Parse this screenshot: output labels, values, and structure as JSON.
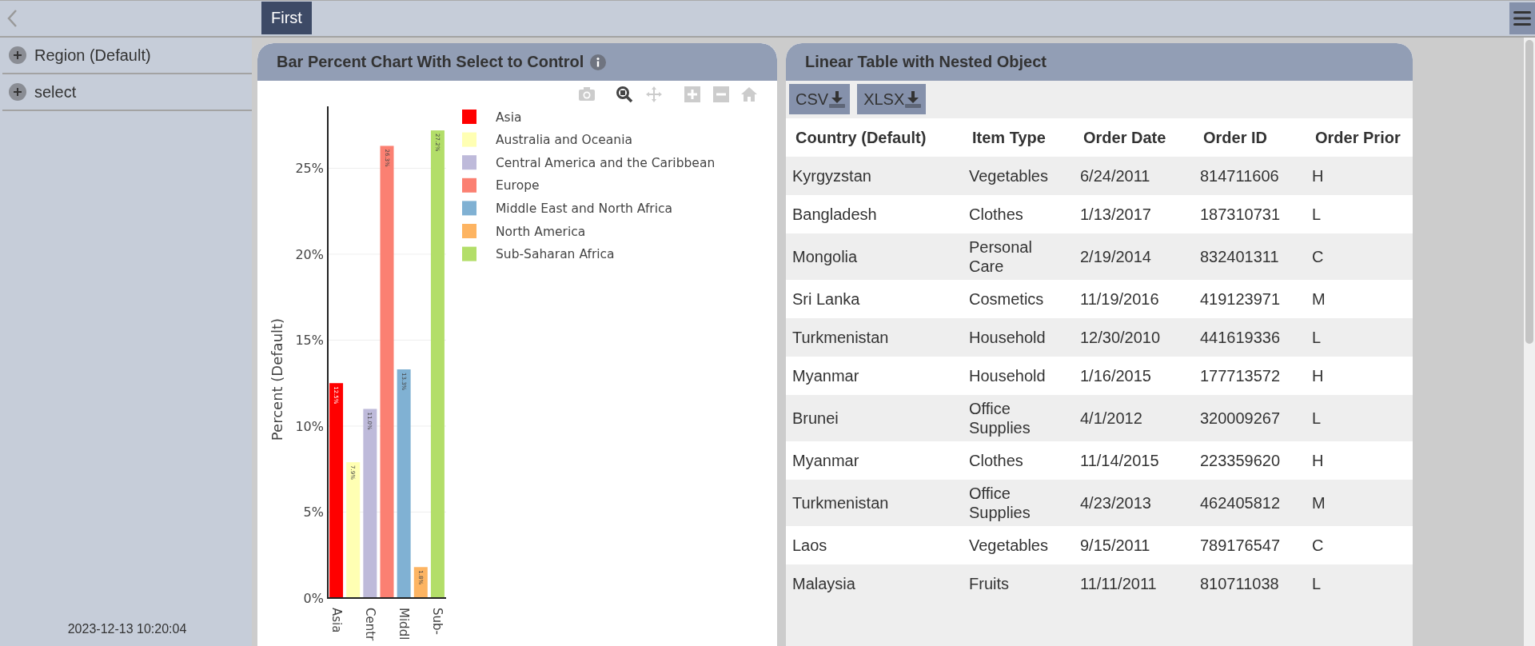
{
  "topbar": {
    "tabs": [
      {
        "label": "First",
        "selected": true
      }
    ]
  },
  "sidebar": {
    "filters": [
      {
        "label": "Region (Default)",
        "expanded": false
      },
      {
        "label": "select",
        "expanded": false
      }
    ],
    "timestamp": "2023-12-13 10:20:04"
  },
  "chart_panel": {
    "title": "Bar Percent Chart With Select to Control",
    "chart_data": {
      "type": "bar",
      "ylabel": "Percent (Default)",
      "categories": [
        "Asia",
        null,
        "Centr",
        null,
        "Middl",
        null,
        "Sub-"
      ],
      "grid": true,
      "legend": "right",
      "series": [
        {
          "name": "Asia",
          "color": "#ff0000",
          "values": [
            12.5,
            null,
            null,
            null,
            null,
            null,
            null
          ]
        },
        {
          "name": "Australia and Oceania",
          "color": "#ffffb3",
          "values": [
            null,
            7.9,
            null,
            null,
            null,
            null,
            null
          ]
        },
        {
          "name": "Central America and the Caribbean",
          "color": "#bebada",
          "values": [
            null,
            null,
            11.0,
            null,
            null,
            null,
            null
          ]
        },
        {
          "name": "Europe",
          "color": "#fb8072",
          "values": [
            null,
            null,
            null,
            26.3,
            null,
            null,
            null
          ]
        },
        {
          "name": "Middle East and North Africa",
          "color": "#80b1d3",
          "values": [
            null,
            null,
            null,
            null,
            13.3,
            null,
            null
          ]
        },
        {
          "name": "North America",
          "color": "#fdb462",
          "values": [
            null,
            null,
            null,
            null,
            null,
            1.8,
            null
          ]
        },
        {
          "name": "Sub-Saharan Africa",
          "color": "#b3de69",
          "values": [
            null,
            null,
            null,
            null,
            null,
            null,
            27.2
          ]
        }
      ],
      "value_labels": [
        "12.5%",
        "7.9%",
        "11.0%",
        "26.3%",
        "13.3%",
        "1.8%",
        "27.2%"
      ],
      "ylim": [
        0,
        28.6
      ],
      "yticks": [
        {
          "value": 0,
          "label": "0%"
        },
        {
          "value": 5,
          "label": "5%"
        },
        {
          "value": 10,
          "label": "10%"
        },
        {
          "value": 15,
          "label": "15%"
        },
        {
          "value": 20,
          "label": "20%"
        },
        {
          "value": 25,
          "label": "25%"
        }
      ]
    }
  },
  "table_panel": {
    "title": "Linear Table with Nested Object",
    "export_buttons": [
      "CSV",
      "XLSX"
    ],
    "table": {
      "columns": [
        "Country (Default)",
        "Item Type",
        "Order Date",
        "Order ID",
        "Order Prior"
      ],
      "rows": [
        [
          "Kyrgyzstan",
          "Vegetables",
          "6/24/2011",
          "814711606",
          "H"
        ],
        [
          "Bangladesh",
          "Clothes",
          "1/13/2017",
          "187310731",
          "L"
        ],
        [
          "Mongolia",
          "Personal Care",
          "2/19/2014",
          "832401311",
          "C"
        ],
        [
          "Sri Lanka",
          "Cosmetics",
          "11/19/2016",
          "419123971",
          "M"
        ],
        [
          "Turkmenistan",
          "Household",
          "12/30/2010",
          "441619336",
          "L"
        ],
        [
          "Myanmar",
          "Household",
          "1/16/2015",
          "177713572",
          "H"
        ],
        [
          "Brunei",
          "Office Supplies",
          "4/1/2012",
          "320009267",
          "L"
        ],
        [
          "Myanmar",
          "Clothes",
          "11/14/2015",
          "223359620",
          "H"
        ],
        [
          "Turkmenistan",
          "Office Supplies",
          "4/23/2013",
          "462405812",
          "M"
        ],
        [
          "Laos",
          "Vegetables",
          "9/15/2011",
          "789176547",
          "C"
        ],
        [
          "Malaysia",
          "Fruits",
          "11/11/2011",
          "810711038",
          "L"
        ]
      ]
    }
  }
}
